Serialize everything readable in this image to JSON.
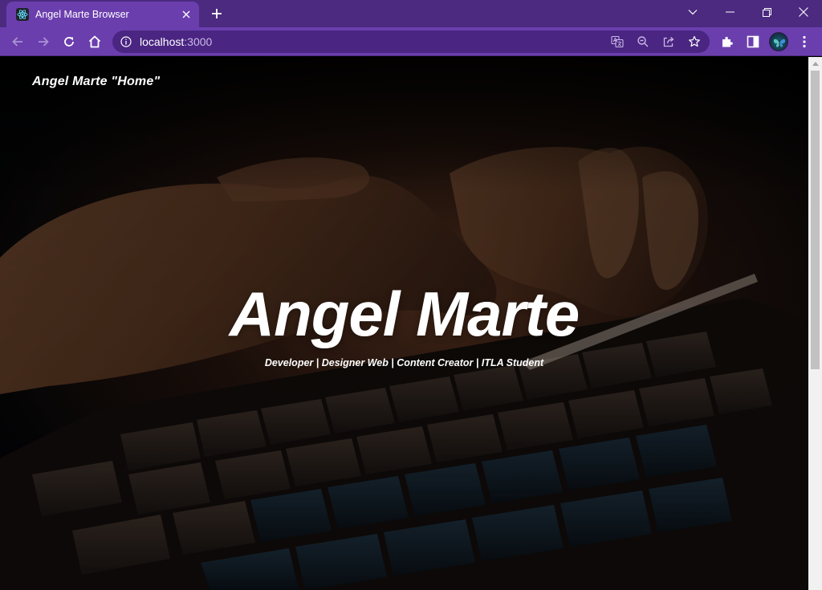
{
  "browser": {
    "tab": {
      "title": "Angel Marte Browser",
      "favicon": "react-atom-icon"
    },
    "address": {
      "host": "localhost",
      "port": ":3000"
    },
    "colors": {
      "frame": "#4b2a7f",
      "toolbar": "#6b3eae",
      "omnibox": "#4a2582"
    }
  },
  "page": {
    "brand": "Angel Marte \"Home\"",
    "hero": {
      "title": "Angel Marte",
      "subtitle": "Developer | Designer Web | Content Creator | ITLA Student"
    },
    "background": "keyboard-typing-photo"
  }
}
